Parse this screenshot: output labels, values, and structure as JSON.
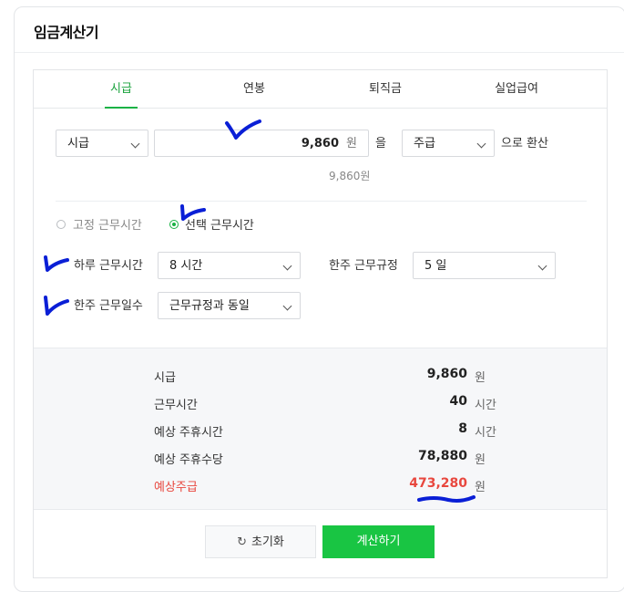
{
  "title": "임금계산기",
  "tabs": [
    "시급",
    "연봉",
    "퇴직금",
    "실업급여"
  ],
  "converter": {
    "unit_select": "시급",
    "amount_value": "9,860",
    "amount_unit": "원",
    "particle": "을",
    "target_select": "주급",
    "suffix": "으로 환산",
    "amount_hint": "9,860원"
  },
  "work_mode": {
    "fixed_label": "고정 근무시간",
    "selected_label": "선택 근무시간",
    "selected": "선택 근무시간"
  },
  "fields": {
    "daily_hours_label": "하루 근무시간",
    "daily_hours_value": "8 시간",
    "weekly_rule_label": "한주 근무규정",
    "weekly_rule_value": "5 일",
    "weekly_days_label": "한주 근무일수",
    "weekly_days_value": "근무규정과 동일"
  },
  "summary": [
    {
      "label": "시급",
      "value": "9,860",
      "unit": "원"
    },
    {
      "label": "근무시간",
      "value": "40",
      "unit": "시간"
    },
    {
      "label": "예상 주휴시간",
      "value": "8",
      "unit": "시간"
    },
    {
      "label": "예상 주휴수당",
      "value": "78,880",
      "unit": "원"
    },
    {
      "label": "예상주급",
      "value": "473,280",
      "unit": "원"
    }
  ],
  "buttons": {
    "reset_icon": "refresh-icon",
    "reset_label": "초기화",
    "calculate_label": "계산하기"
  },
  "colors": {
    "accent_green": "#19c543",
    "highlight_red": "#e8473e",
    "annotation_blue": "#0a1fd6"
  }
}
